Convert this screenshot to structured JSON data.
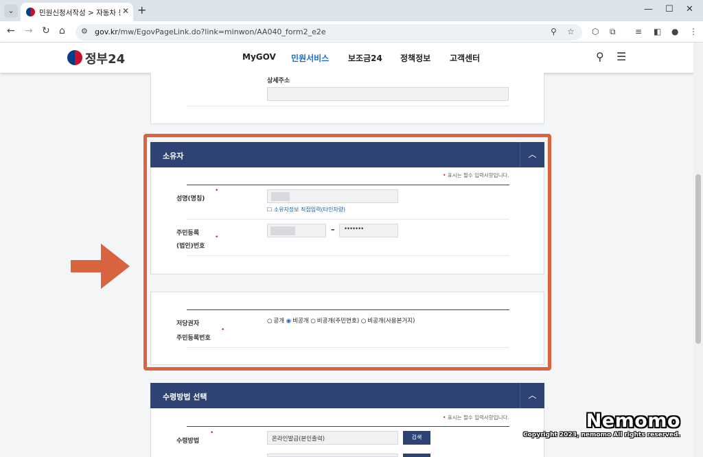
{
  "browser": {
    "tab_title": "민원신청서작성 > 자동차 등록",
    "url_domain": "gov.kr",
    "url_path": "/mw/EgovPageLink.do?link=minwon/AA040_form2_e2e"
  },
  "site": {
    "logo": "정부24",
    "nav": [
      "MyGOV",
      "민원서비스",
      "보조금24",
      "정책정보",
      "고객센터"
    ],
    "active_nav_index": 1
  },
  "address_section": {
    "detail_address_label": "상세주소"
  },
  "owner_section": {
    "title": "소유자",
    "required_note": "표시는 필수 입력사항입니다.",
    "name_label": "성명(명칭)",
    "direct_input_checkbox": "소유자정보 직접입력(타인차량)",
    "rrn_label_line1": "주민등록",
    "rrn_label_line2": "(법인)번호",
    "rrn_separator": "–",
    "rrn_back_placeholder": "•••••••"
  },
  "mortgagee_section": {
    "label_line1": "저당권자",
    "label_line2": "주민등록번호",
    "options": [
      "공개",
      "비공개",
      "비공개(주민번호)",
      "비공개(사용본거지)"
    ],
    "selected_index": 1
  },
  "receipt_section": {
    "title": "수령방법 선택",
    "required_note": "표시는 필수 입력사항입니다.",
    "method_label": "수령방법",
    "method_value": "온라인발급(본인출력)",
    "search_button": "검색"
  },
  "watermark": {
    "title": "Nemomo",
    "copyright": "Copyright 2023, nemomo All rights reserved."
  },
  "colors": {
    "section_header": "#2e4373",
    "highlight_box": "#d8643f",
    "required_mark": "#d9232e",
    "active_nav": "#1a6dc4"
  }
}
